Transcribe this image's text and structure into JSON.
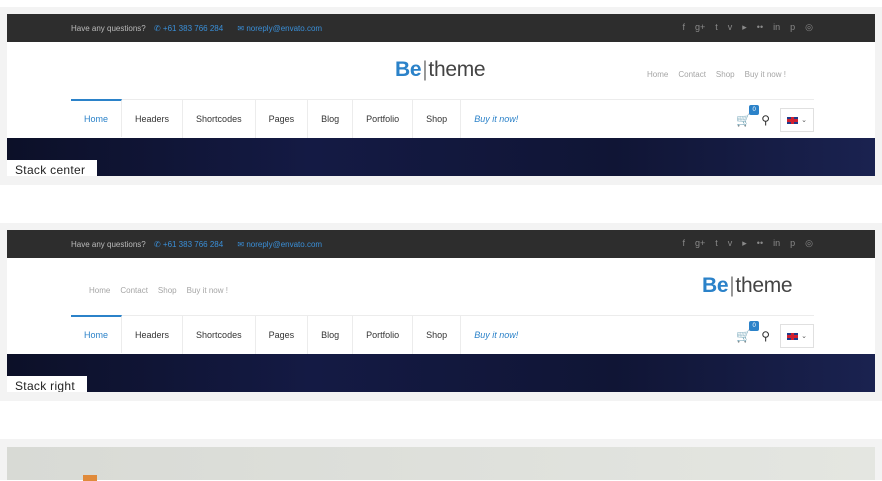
{
  "topbar": {
    "question": "Have any questions?",
    "phone": "+61 383 766 284",
    "email": "noreply@envato.com",
    "social_icons": [
      "facebook-icon",
      "google-plus-icon",
      "twitter-icon",
      "vimeo-icon",
      "youtube-icon",
      "flickr-icon",
      "linkedin-icon",
      "pinterest-icon",
      "dribbble-icon"
    ]
  },
  "logo": {
    "be": "Be",
    "separator": "|",
    "theme": "theme"
  },
  "secondary_menu": [
    "Home",
    "Contact",
    "Shop",
    "Buy it now !"
  ],
  "nav": [
    "Home",
    "Headers",
    "Shortcodes",
    "Pages",
    "Blog",
    "Portfolio",
    "Shop",
    "Buy it now!"
  ],
  "cart_count": "0",
  "labels": {
    "center": "Stack center",
    "right": "Stack right"
  },
  "colors": {
    "accent": "#2b82c9",
    "topbar": "#2d2d2d",
    "hero": "#101535"
  }
}
